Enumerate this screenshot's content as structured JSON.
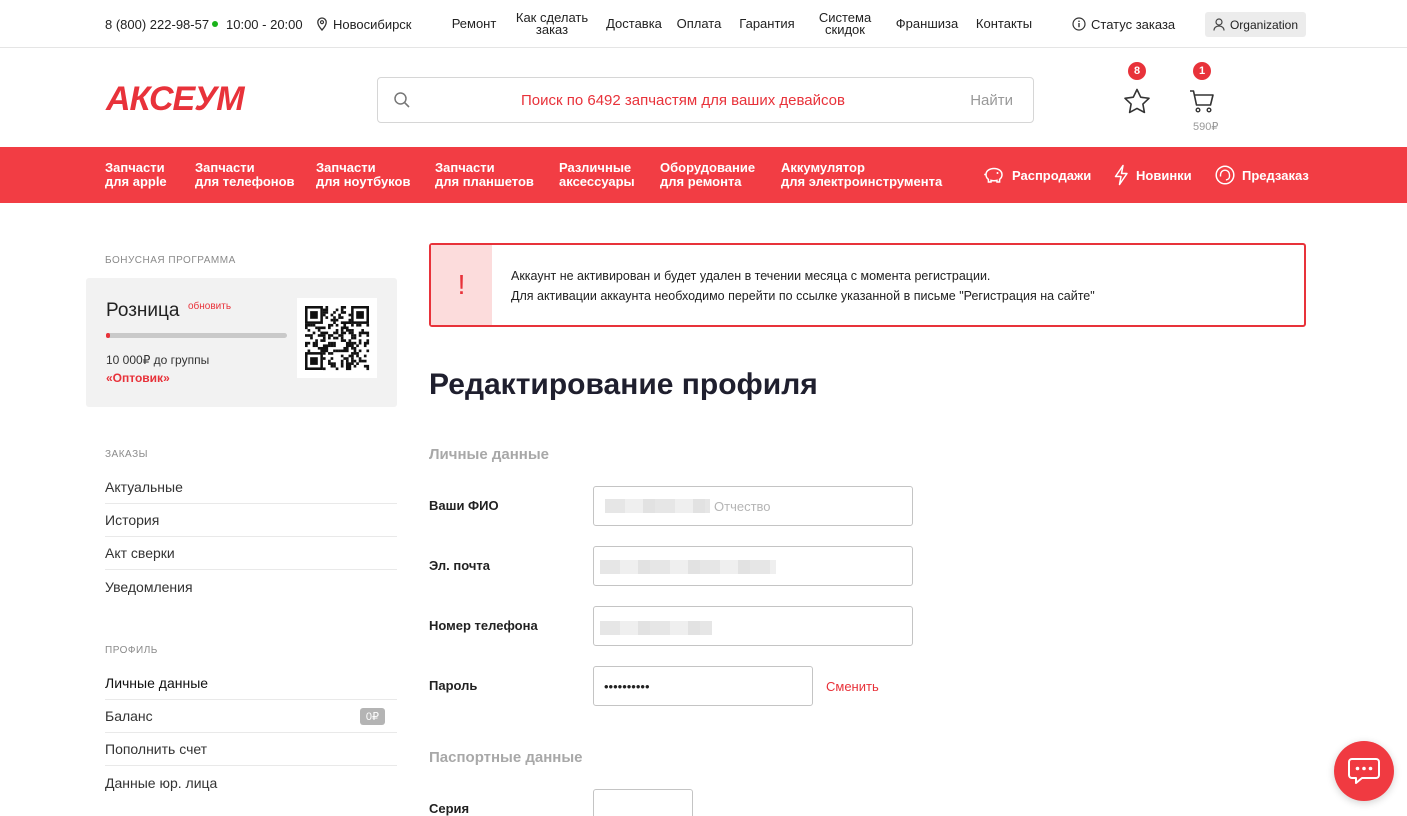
{
  "topbar": {
    "phone": "8 (800) 222-98-57",
    "hours": "10:00 - 20:00",
    "city": "Новосибирск",
    "nav": [
      {
        "label": "Ремонт"
      },
      {
        "label": "Как сделать заказ"
      },
      {
        "label": "Доставка"
      },
      {
        "label": "Оплата"
      },
      {
        "label": "Гарантия"
      },
      {
        "label": "Система скидок"
      },
      {
        "label": "Франшиза"
      },
      {
        "label": "Контакты"
      }
    ],
    "order_status": "Статус заказа",
    "account": "Organization"
  },
  "header": {
    "logo": "АКСЕУМ",
    "search_placeholder": "Поиск по 6492 запчастям для ваших девайсов",
    "search_button": "Найти",
    "favorites_count": "8",
    "cart_count": "1",
    "cart_total": "590₽"
  },
  "catalog_nav": {
    "items": [
      {
        "line1": "Запчасти",
        "line2": "для apple"
      },
      {
        "line1": "Запчасти",
        "line2": "для телефонов"
      },
      {
        "line1": "Запчасти",
        "line2": "для ноутбуков"
      },
      {
        "line1": "Запчасти",
        "line2": "для планшетов"
      },
      {
        "line1": "Различные",
        "line2": "аксессуары"
      },
      {
        "line1": "Оборудование",
        "line2": "для ремонта"
      },
      {
        "line1": "Аккумулятор",
        "line2": "для электроинструмента"
      }
    ],
    "extras": [
      {
        "label": "Распродажи",
        "icon": "piggy-bank-icon"
      },
      {
        "label": "Новинки",
        "icon": "lightning-icon"
      },
      {
        "label": "Предзаказ",
        "icon": "headset-icon"
      }
    ]
  },
  "sidebar": {
    "bonus": {
      "section_title": "БОНУСНАЯ ПРОГРАММА",
      "tier": "Розница",
      "refresh": "обновить",
      "progress": 0.02,
      "to_next": "10 000₽ до группы",
      "next_group": "«Оптовик»"
    },
    "orders": {
      "section_title": "ЗАКАЗЫ",
      "items": [
        "Актуальные",
        "История",
        "Акт сверки",
        "Уведомления"
      ]
    },
    "profile": {
      "section_title": "ПРОФИЛЬ",
      "items": [
        "Личные данные",
        "Баланс",
        "Пополнить счет",
        "Данные юр. лица"
      ],
      "balance_badge": "0₽"
    }
  },
  "alert": {
    "icon": "!",
    "line1": "Аккаунт не активирован и будет удален в течении месяца с момента регистрации.",
    "line2": "Для активации аккаунта необходимо перейти по ссылке указанной в письме \"Регистрация на сайте\""
  },
  "form": {
    "title": "Редактирование профиля",
    "personal_title": "Личные данные",
    "fio_label": "Ваши ФИО",
    "fio_placeholder": "Отчество",
    "email_label": "Эл. почта",
    "phone_label": "Номер телефона",
    "password_label": "Пароль",
    "password_value": "••••••••••",
    "change_link": "Сменить",
    "passport_title": "Паспортные данные",
    "series_label": "Серия"
  },
  "colors": {
    "accent": "#f23d44",
    "brand": "#e8323a"
  }
}
